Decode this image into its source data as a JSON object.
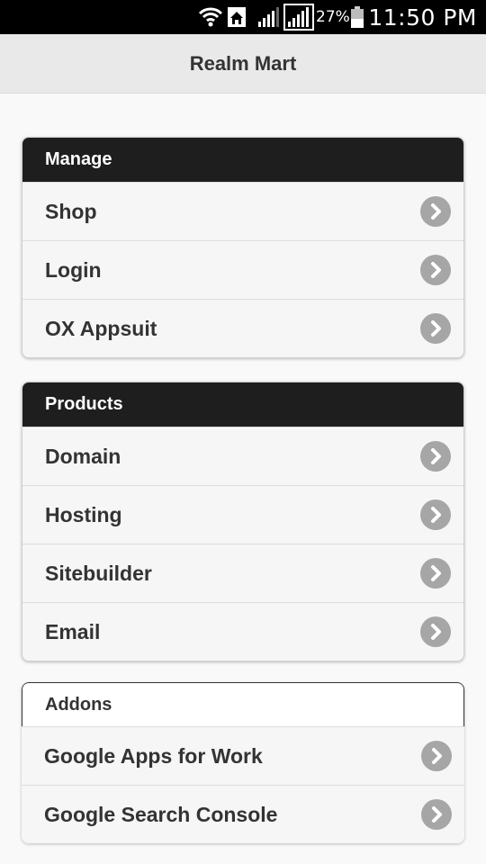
{
  "status_bar": {
    "battery_percent": "27%",
    "time": "11:50 PM"
  },
  "header": {
    "title": "Realm Mart"
  },
  "groups": [
    {
      "title": "Manage",
      "items": [
        {
          "label": "Shop"
        },
        {
          "label": "Login"
        },
        {
          "label": "OX Appsuit"
        }
      ]
    },
    {
      "title": "Products",
      "items": [
        {
          "label": "Domain"
        },
        {
          "label": "Hosting"
        },
        {
          "label": "Sitebuilder"
        },
        {
          "label": "Email"
        }
      ]
    },
    {
      "title": "Addons",
      "items": [
        {
          "label": "Google Apps for Work"
        },
        {
          "label": "Google Search Console"
        }
      ]
    }
  ],
  "colors": {
    "group_header_dark": "#1e1e1e",
    "arrow_circle": "#a6a6a6",
    "header_bg": "#e9e9e9"
  }
}
